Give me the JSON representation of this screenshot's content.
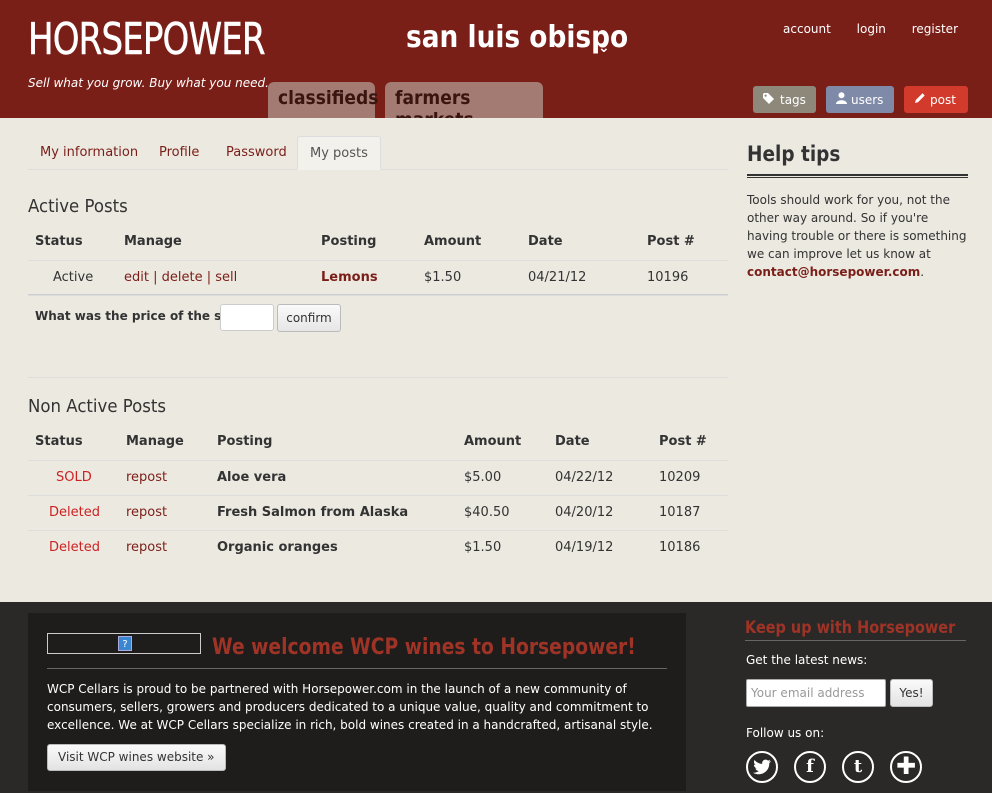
{
  "header": {
    "logo": "HORSEPOWER",
    "tagline": "Sell what you grow. Buy what you need.",
    "city": "san luis obispo",
    "account_links": [
      "account",
      "login",
      "register"
    ],
    "main_tabs": [
      "classifieds",
      "farmers markets"
    ],
    "buttons": {
      "tags": "tags",
      "users": "users",
      "post": "post"
    },
    "colors": {
      "header_bg": "#7a1e18",
      "tab_bg": "#a37b73",
      "tags_btn": "#8e887a",
      "users_btn": "#7f8aa8",
      "post_btn": "#d23a2c"
    }
  },
  "subtabs": [
    "My information",
    "Profile",
    "Password",
    "My posts"
  ],
  "active_subtab": "My posts",
  "active_posts": {
    "title": "Active Posts",
    "columns": [
      "Status",
      "Manage",
      "Posting",
      "Amount",
      "Date",
      "Post #"
    ],
    "rows": [
      {
        "status": "Active",
        "manage": [
          "edit",
          "delete",
          "sell"
        ],
        "posting": "Lemons",
        "amount": "$1.50",
        "date": "04/21/12",
        "post_no": "10196"
      }
    ],
    "sell_question": "What was the price of the sell?",
    "sell_input": "",
    "confirm_label": "confirm"
  },
  "non_active_posts": {
    "title": "Non Active Posts",
    "columns": [
      "Status",
      "Manage",
      "Posting",
      "Amount",
      "Date",
      "Post #"
    ],
    "rows": [
      {
        "status": "SOLD",
        "manage": "repost",
        "posting": "Aloe vera",
        "amount": "$5.00",
        "date": "04/22/12",
        "post_no": "10209"
      },
      {
        "status": "Deleted",
        "manage": "repost",
        "posting": "Fresh Salmon from Alaska",
        "amount": "$40.50",
        "date": "04/20/12",
        "post_no": "10187"
      },
      {
        "status": "Deleted",
        "manage": "repost",
        "posting": "Organic oranges",
        "amount": "$1.50",
        "date": "04/19/12",
        "post_no": "10186"
      }
    ]
  },
  "help": {
    "title": "Help tips",
    "text": "Tools should work for you, not the other way around. So if you're having trouble or there is something we can improve let us know at",
    "email": "contact@horsepower.com",
    "email_suffix": "."
  },
  "footer": {
    "promo_title": "We welcome WCP wines to Horsepower!",
    "promo_text": "WCP Cellars is proud to be partnered with Horsepower.com in the launch of a new community of consumers, sellers, growers and producers dedicated to a unique value, quality and commitment to excellence. We at WCP Cellars specialize in rich, bold wines created in a handcrafted, artisanal style.",
    "promo_button": "Visit WCP wines website »",
    "keep_title": "Keep up with Horsepower",
    "latest_news": "Get the latest news:",
    "email_placeholder": "Your email address",
    "yes_label": "Yes!",
    "follow_label": "Follow us on:",
    "social_icons": [
      "twitter-icon",
      "facebook-icon",
      "tumblr-icon",
      "plus-icon"
    ]
  }
}
